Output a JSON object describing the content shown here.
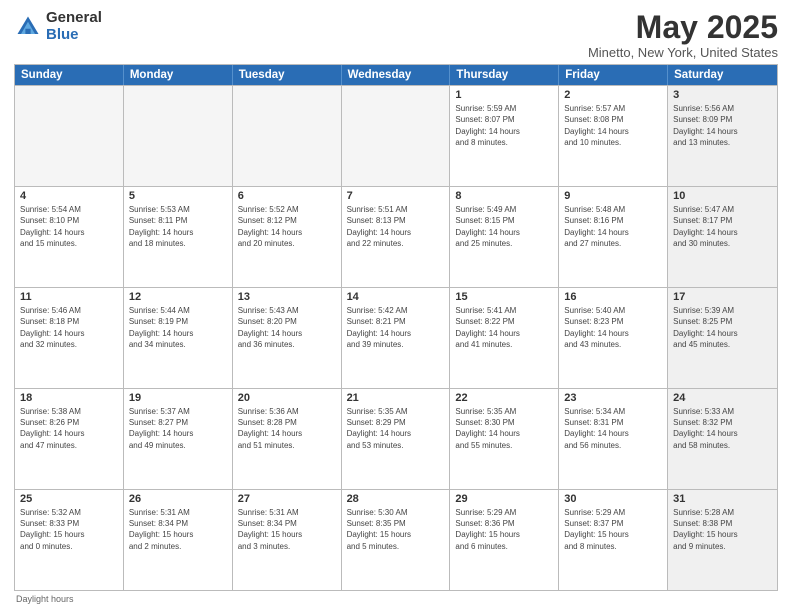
{
  "logo": {
    "general": "General",
    "blue": "Blue"
  },
  "title": "May 2025",
  "subtitle": "Minetto, New York, United States",
  "days_of_week": [
    "Sunday",
    "Monday",
    "Tuesday",
    "Wednesday",
    "Thursday",
    "Friday",
    "Saturday"
  ],
  "footer": "Daylight hours",
  "weeks": [
    [
      {
        "day": "",
        "empty": true
      },
      {
        "day": "",
        "empty": true
      },
      {
        "day": "",
        "empty": true
      },
      {
        "day": "",
        "empty": true
      },
      {
        "day": "1",
        "info": "Sunrise: 5:59 AM\nSunset: 8:07 PM\nDaylight: 14 hours\nand 8 minutes."
      },
      {
        "day": "2",
        "info": "Sunrise: 5:57 AM\nSunset: 8:08 PM\nDaylight: 14 hours\nand 10 minutes."
      },
      {
        "day": "3",
        "info": "Sunrise: 5:56 AM\nSunset: 8:09 PM\nDaylight: 14 hours\nand 13 minutes.",
        "shaded": true
      }
    ],
    [
      {
        "day": "4",
        "info": "Sunrise: 5:54 AM\nSunset: 8:10 PM\nDaylight: 14 hours\nand 15 minutes."
      },
      {
        "day": "5",
        "info": "Sunrise: 5:53 AM\nSunset: 8:11 PM\nDaylight: 14 hours\nand 18 minutes."
      },
      {
        "day": "6",
        "info": "Sunrise: 5:52 AM\nSunset: 8:12 PM\nDaylight: 14 hours\nand 20 minutes."
      },
      {
        "day": "7",
        "info": "Sunrise: 5:51 AM\nSunset: 8:13 PM\nDaylight: 14 hours\nand 22 minutes."
      },
      {
        "day": "8",
        "info": "Sunrise: 5:49 AM\nSunset: 8:15 PM\nDaylight: 14 hours\nand 25 minutes."
      },
      {
        "day": "9",
        "info": "Sunrise: 5:48 AM\nSunset: 8:16 PM\nDaylight: 14 hours\nand 27 minutes."
      },
      {
        "day": "10",
        "info": "Sunrise: 5:47 AM\nSunset: 8:17 PM\nDaylight: 14 hours\nand 30 minutes.",
        "shaded": true
      }
    ],
    [
      {
        "day": "11",
        "info": "Sunrise: 5:46 AM\nSunset: 8:18 PM\nDaylight: 14 hours\nand 32 minutes."
      },
      {
        "day": "12",
        "info": "Sunrise: 5:44 AM\nSunset: 8:19 PM\nDaylight: 14 hours\nand 34 minutes."
      },
      {
        "day": "13",
        "info": "Sunrise: 5:43 AM\nSunset: 8:20 PM\nDaylight: 14 hours\nand 36 minutes."
      },
      {
        "day": "14",
        "info": "Sunrise: 5:42 AM\nSunset: 8:21 PM\nDaylight: 14 hours\nand 39 minutes."
      },
      {
        "day": "15",
        "info": "Sunrise: 5:41 AM\nSunset: 8:22 PM\nDaylight: 14 hours\nand 41 minutes."
      },
      {
        "day": "16",
        "info": "Sunrise: 5:40 AM\nSunset: 8:23 PM\nDaylight: 14 hours\nand 43 minutes."
      },
      {
        "day": "17",
        "info": "Sunrise: 5:39 AM\nSunset: 8:25 PM\nDaylight: 14 hours\nand 45 minutes.",
        "shaded": true
      }
    ],
    [
      {
        "day": "18",
        "info": "Sunrise: 5:38 AM\nSunset: 8:26 PM\nDaylight: 14 hours\nand 47 minutes."
      },
      {
        "day": "19",
        "info": "Sunrise: 5:37 AM\nSunset: 8:27 PM\nDaylight: 14 hours\nand 49 minutes."
      },
      {
        "day": "20",
        "info": "Sunrise: 5:36 AM\nSunset: 8:28 PM\nDaylight: 14 hours\nand 51 minutes."
      },
      {
        "day": "21",
        "info": "Sunrise: 5:35 AM\nSunset: 8:29 PM\nDaylight: 14 hours\nand 53 minutes."
      },
      {
        "day": "22",
        "info": "Sunrise: 5:35 AM\nSunset: 8:30 PM\nDaylight: 14 hours\nand 55 minutes."
      },
      {
        "day": "23",
        "info": "Sunrise: 5:34 AM\nSunset: 8:31 PM\nDaylight: 14 hours\nand 56 minutes."
      },
      {
        "day": "24",
        "info": "Sunrise: 5:33 AM\nSunset: 8:32 PM\nDaylight: 14 hours\nand 58 minutes.",
        "shaded": true
      }
    ],
    [
      {
        "day": "25",
        "info": "Sunrise: 5:32 AM\nSunset: 8:33 PM\nDaylight: 15 hours\nand 0 minutes."
      },
      {
        "day": "26",
        "info": "Sunrise: 5:31 AM\nSunset: 8:34 PM\nDaylight: 15 hours\nand 2 minutes."
      },
      {
        "day": "27",
        "info": "Sunrise: 5:31 AM\nSunset: 8:34 PM\nDaylight: 15 hours\nand 3 minutes."
      },
      {
        "day": "28",
        "info": "Sunrise: 5:30 AM\nSunset: 8:35 PM\nDaylight: 15 hours\nand 5 minutes."
      },
      {
        "day": "29",
        "info": "Sunrise: 5:29 AM\nSunset: 8:36 PM\nDaylight: 15 hours\nand 6 minutes."
      },
      {
        "day": "30",
        "info": "Sunrise: 5:29 AM\nSunset: 8:37 PM\nDaylight: 15 hours\nand 8 minutes."
      },
      {
        "day": "31",
        "info": "Sunrise: 5:28 AM\nSunset: 8:38 PM\nDaylight: 15 hours\nand 9 minutes.",
        "shaded": true
      }
    ]
  ]
}
